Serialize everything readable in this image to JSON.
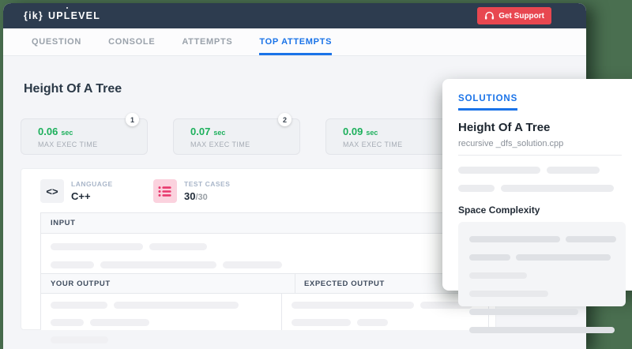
{
  "header": {
    "logo": {
      "braces": "{ik}",
      "name_pre": "UP",
      "name_mid": "L",
      "name_post": "EVEL"
    },
    "support_button": "Get Support"
  },
  "tabs": [
    {
      "label": "QUESTION",
      "active": false
    },
    {
      "label": "CONSOLE",
      "active": false
    },
    {
      "label": "ATTEMPTS",
      "active": false
    },
    {
      "label": "TOP ATTEMPTS",
      "active": true
    }
  ],
  "page": {
    "title": "Height Of A Tree"
  },
  "exec_cards": [
    {
      "rank": "1",
      "value": "0.06",
      "unit": "sec",
      "label": "MAX EXEC TIME"
    },
    {
      "rank": "2",
      "value": "0.07",
      "unit": "sec",
      "label": "MAX EXEC TIME"
    },
    {
      "value": "0.09",
      "unit": "sec",
      "label": "MAX EXEC TIME"
    }
  ],
  "attempt": {
    "language": {
      "label": "LANGUAGE",
      "value": "C++",
      "icon_glyph": "<>"
    },
    "test_cases": {
      "label": "TEST CASES",
      "passed": "30",
      "total": "/30"
    },
    "table": {
      "input_header": "INPUT",
      "your_output_header": "YOUR OUTPUT",
      "expected_output_header": "EXPECTED OUTPUT"
    }
  },
  "solutions": {
    "tab_label": "SOLUTIONS",
    "title": "Height Of A Tree",
    "filename": "recursive _dfs_solution.cpp",
    "section_title": "Space Complexity"
  },
  "colors": {
    "backdrop_green": "#4a6f50",
    "header_navy": "#2d3c4f",
    "accent_blue": "#1a73e8",
    "success_green": "#1db05c",
    "support_red": "#e84750",
    "test_icon_pink_bg": "#fbd2de",
    "test_icon_pink": "#e8386d"
  }
}
